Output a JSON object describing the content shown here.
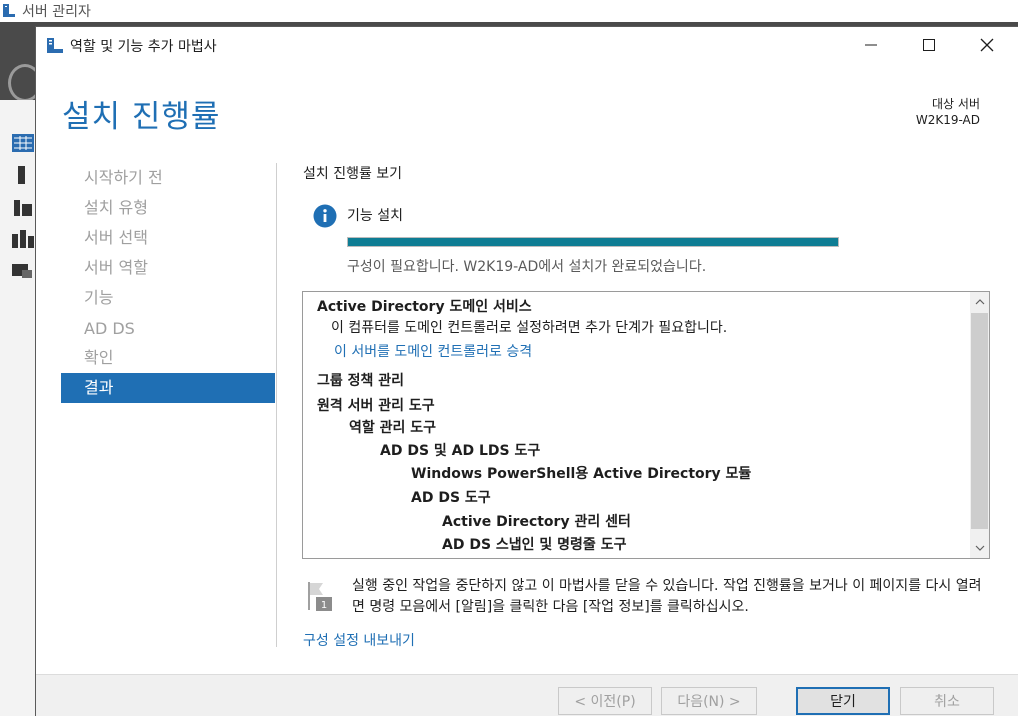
{
  "background": {
    "title": "서버 관리자"
  },
  "wizard": {
    "title": "역할 및 기능 추가 마법사",
    "page_title": "설치 진행률",
    "destination_label": "대상 서버",
    "destination_server": "W2K19-AD"
  },
  "nav": {
    "items": [
      {
        "label": "시작하기 전",
        "active": false
      },
      {
        "label": "설치 유형",
        "active": false
      },
      {
        "label": "서버 선택",
        "active": false
      },
      {
        "label": "서버 역할",
        "active": false
      },
      {
        "label": "기능",
        "active": false
      },
      {
        "label": "AD DS",
        "active": false
      },
      {
        "label": "확인",
        "active": false
      },
      {
        "label": "결과",
        "active": true
      }
    ]
  },
  "progress": {
    "heading": "설치 진행률 보기",
    "feature_label": "기능 설치",
    "percent": 100,
    "status": "구성이 필요합니다. W2K19-AD에서 설치가 완료되었습니다."
  },
  "results": {
    "lines": [
      {
        "text": "Active Directory 도메인 서비스",
        "bold": true
      },
      {
        "text": "이 컴퓨터를 도메인 컨트롤러로 설정하려면 추가 단계가 필요합니다.",
        "bold": false
      },
      {
        "text": "이 서버를 도메인 컨트롤러로 승격",
        "link": true
      },
      {
        "text": "그룹 정책 관리",
        "bold": true
      },
      {
        "text": "원격 서버 관리 도구",
        "bold": true
      },
      {
        "text": "역할 관리 도구",
        "bold": true
      },
      {
        "text": "AD DS 및 AD LDS 도구",
        "bold": true
      },
      {
        "text": "Windows PowerShell용 Active Directory 모듈",
        "bold": true
      },
      {
        "text": "AD DS 도구",
        "bold": true
      },
      {
        "text": "Active Directory 관리 센터",
        "bold": true
      },
      {
        "text": "AD DS 스냅인 및 명령줄 도구",
        "bold": true
      }
    ]
  },
  "note": {
    "badge": "1",
    "text": "실행 중인 작업을 중단하지 않고 이 마법사를 닫을 수 있습니다. 작업 진행률을 보거나 이 페이지를 다시 열려면 명령 모음에서 [알림]을 클릭한 다음 [작업 정보]를 클릭하십시오."
  },
  "export_link": "구성 설정 내보내기",
  "buttons": {
    "prev": "< 이전(P)",
    "next": "다음(N) >",
    "close": "닫기",
    "cancel": "취소"
  },
  "colors": {
    "accent": "#1f6fb4",
    "progress": "#0e7d94"
  }
}
